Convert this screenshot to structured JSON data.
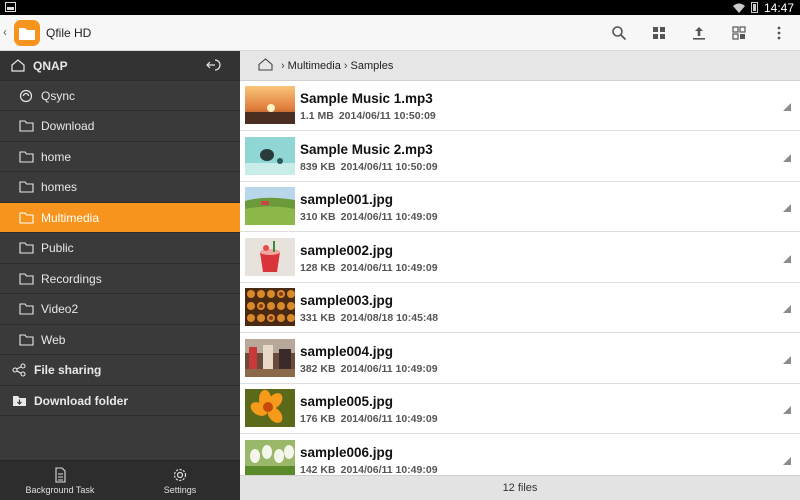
{
  "status_bar": {
    "time": "14:47"
  },
  "app": {
    "title": "Qfile HD"
  },
  "sidebar": {
    "root": {
      "label": "QNAP"
    },
    "items": [
      {
        "label": "Qsync",
        "icon": "sync-icon"
      },
      {
        "label": "Download",
        "icon": "folder-icon"
      },
      {
        "label": "home",
        "icon": "folder-icon"
      },
      {
        "label": "homes",
        "icon": "folder-icon"
      },
      {
        "label": "Multimedia",
        "icon": "folder-icon",
        "active": true
      },
      {
        "label": "Public",
        "icon": "folder-icon"
      },
      {
        "label": "Recordings",
        "icon": "folder-icon"
      },
      {
        "label": "Video2",
        "icon": "folder-icon"
      },
      {
        "label": "Web",
        "icon": "folder-icon"
      }
    ],
    "sections": [
      {
        "label": "File sharing",
        "icon": "share-icon"
      },
      {
        "label": "Download folder",
        "icon": "download-folder-icon"
      }
    ],
    "bottom": {
      "background_task": "Background Task",
      "settings": "Settings"
    }
  },
  "breadcrumb": {
    "items": [
      "Multimedia",
      "Samples"
    ]
  },
  "files": [
    {
      "name": "Sample Music 1.mp3",
      "size": "1.1 MB",
      "date": "2014/06/11 10:50:09"
    },
    {
      "name": "Sample Music 2.mp3",
      "size": "839 KB",
      "date": "2014/06/11 10:50:09"
    },
    {
      "name": "sample001.jpg",
      "size": "310 KB",
      "date": "2014/06/11 10:49:09"
    },
    {
      "name": "sample002.jpg",
      "size": "128 KB",
      "date": "2014/06/11 10:49:09"
    },
    {
      "name": "sample003.jpg",
      "size": "331 KB",
      "date": "2014/08/18 10:45:48"
    },
    {
      "name": "sample004.jpg",
      "size": "382 KB",
      "date": "2014/06/11 10:49:09"
    },
    {
      "name": "sample005.jpg",
      "size": "176 KB",
      "date": "2014/06/11 10:49:09"
    },
    {
      "name": "sample006.jpg",
      "size": "142 KB",
      "date": "2014/06/11 10:49:09"
    }
  ],
  "footer": {
    "count": "12 files"
  },
  "colors": {
    "accent": "#f7941d",
    "sidebar": "#3a3a3a"
  }
}
